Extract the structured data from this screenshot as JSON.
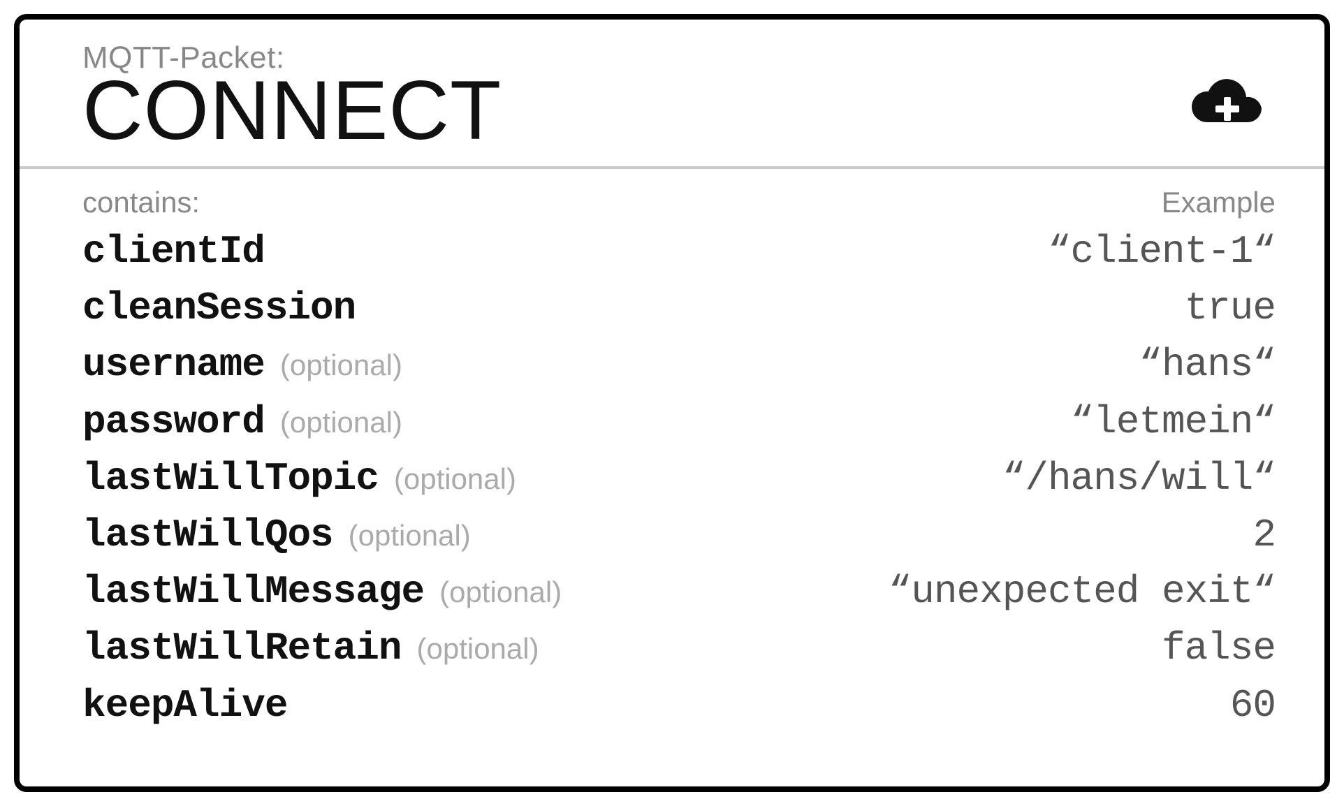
{
  "header": {
    "eyebrow": "MQTT-Packet:",
    "packet_name": "CONNECT"
  },
  "body": {
    "contains_label": "contains:",
    "example_label": "Example",
    "optional_text": "(optional)"
  },
  "fields": [
    {
      "name": "clientId",
      "optional": false,
      "example": "“client-1“"
    },
    {
      "name": "cleanSession",
      "optional": false,
      "example": "true"
    },
    {
      "name": "username",
      "optional": true,
      "example": "“hans“"
    },
    {
      "name": "password",
      "optional": true,
      "example": "“letmein“"
    },
    {
      "name": "lastWillTopic",
      "optional": true,
      "example": "“/hans/will“"
    },
    {
      "name": "lastWillQos",
      "optional": true,
      "example": "2"
    },
    {
      "name": "lastWillMessage",
      "optional": true,
      "example": "“unexpected exit“"
    },
    {
      "name": "lastWillRetain",
      "optional": true,
      "example": "false"
    },
    {
      "name": "keepAlive",
      "optional": false,
      "example": "60"
    }
  ]
}
